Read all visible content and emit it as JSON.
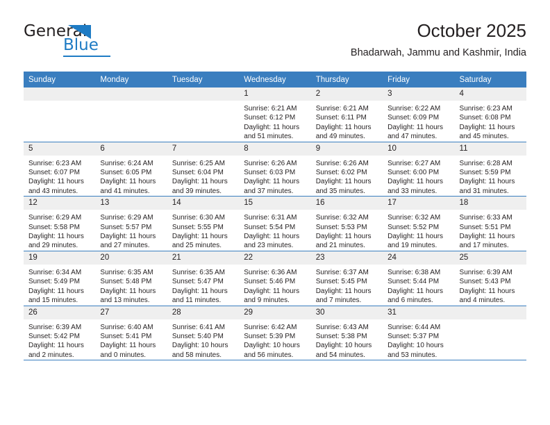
{
  "brand": {
    "name_top": "General",
    "name_bottom": "Blue",
    "accent_color": "#1e7bc4",
    "triangle_icon": "brand-triangle-icon"
  },
  "header": {
    "title": "October 2025",
    "subtitle": "Bhadarwah, Jammu and Kashmir, India"
  },
  "theme": {
    "header_row_bg": "#3a7ebf",
    "daynum_bg": "#efefef",
    "row_border": "#3a7ebf",
    "text": "#231f20"
  },
  "calendar": {
    "weekday_headers": [
      "Sunday",
      "Monday",
      "Tuesday",
      "Wednesday",
      "Thursday",
      "Friday",
      "Saturday"
    ],
    "weeks": [
      [
        {
          "day": "",
          "lines": []
        },
        {
          "day": "",
          "lines": []
        },
        {
          "day": "",
          "lines": []
        },
        {
          "day": "1",
          "lines": [
            "Sunrise: 6:21 AM",
            "Sunset: 6:12 PM",
            "Daylight: 11 hours",
            "and 51 minutes."
          ]
        },
        {
          "day": "2",
          "lines": [
            "Sunrise: 6:21 AM",
            "Sunset: 6:11 PM",
            "Daylight: 11 hours",
            "and 49 minutes."
          ]
        },
        {
          "day": "3",
          "lines": [
            "Sunrise: 6:22 AM",
            "Sunset: 6:09 PM",
            "Daylight: 11 hours",
            "and 47 minutes."
          ]
        },
        {
          "day": "4",
          "lines": [
            "Sunrise: 6:23 AM",
            "Sunset: 6:08 PM",
            "Daylight: 11 hours",
            "and 45 minutes."
          ]
        }
      ],
      [
        {
          "day": "5",
          "lines": [
            "Sunrise: 6:23 AM",
            "Sunset: 6:07 PM",
            "Daylight: 11 hours",
            "and 43 minutes."
          ]
        },
        {
          "day": "6",
          "lines": [
            "Sunrise: 6:24 AM",
            "Sunset: 6:05 PM",
            "Daylight: 11 hours",
            "and 41 minutes."
          ]
        },
        {
          "day": "7",
          "lines": [
            "Sunrise: 6:25 AM",
            "Sunset: 6:04 PM",
            "Daylight: 11 hours",
            "and 39 minutes."
          ]
        },
        {
          "day": "8",
          "lines": [
            "Sunrise: 6:26 AM",
            "Sunset: 6:03 PM",
            "Daylight: 11 hours",
            "and 37 minutes."
          ]
        },
        {
          "day": "9",
          "lines": [
            "Sunrise: 6:26 AM",
            "Sunset: 6:02 PM",
            "Daylight: 11 hours",
            "and 35 minutes."
          ]
        },
        {
          "day": "10",
          "lines": [
            "Sunrise: 6:27 AM",
            "Sunset: 6:00 PM",
            "Daylight: 11 hours",
            "and 33 minutes."
          ]
        },
        {
          "day": "11",
          "lines": [
            "Sunrise: 6:28 AM",
            "Sunset: 5:59 PM",
            "Daylight: 11 hours",
            "and 31 minutes."
          ]
        }
      ],
      [
        {
          "day": "12",
          "lines": [
            "Sunrise: 6:29 AM",
            "Sunset: 5:58 PM",
            "Daylight: 11 hours",
            "and 29 minutes."
          ]
        },
        {
          "day": "13",
          "lines": [
            "Sunrise: 6:29 AM",
            "Sunset: 5:57 PM",
            "Daylight: 11 hours",
            "and 27 minutes."
          ]
        },
        {
          "day": "14",
          "lines": [
            "Sunrise: 6:30 AM",
            "Sunset: 5:55 PM",
            "Daylight: 11 hours",
            "and 25 minutes."
          ]
        },
        {
          "day": "15",
          "lines": [
            "Sunrise: 6:31 AM",
            "Sunset: 5:54 PM",
            "Daylight: 11 hours",
            "and 23 minutes."
          ]
        },
        {
          "day": "16",
          "lines": [
            "Sunrise: 6:32 AM",
            "Sunset: 5:53 PM",
            "Daylight: 11 hours",
            "and 21 minutes."
          ]
        },
        {
          "day": "17",
          "lines": [
            "Sunrise: 6:32 AM",
            "Sunset: 5:52 PM",
            "Daylight: 11 hours",
            "and 19 minutes."
          ]
        },
        {
          "day": "18",
          "lines": [
            "Sunrise: 6:33 AM",
            "Sunset: 5:51 PM",
            "Daylight: 11 hours",
            "and 17 minutes."
          ]
        }
      ],
      [
        {
          "day": "19",
          "lines": [
            "Sunrise: 6:34 AM",
            "Sunset: 5:49 PM",
            "Daylight: 11 hours",
            "and 15 minutes."
          ]
        },
        {
          "day": "20",
          "lines": [
            "Sunrise: 6:35 AM",
            "Sunset: 5:48 PM",
            "Daylight: 11 hours",
            "and 13 minutes."
          ]
        },
        {
          "day": "21",
          "lines": [
            "Sunrise: 6:35 AM",
            "Sunset: 5:47 PM",
            "Daylight: 11 hours",
            "and 11 minutes."
          ]
        },
        {
          "day": "22",
          "lines": [
            "Sunrise: 6:36 AM",
            "Sunset: 5:46 PM",
            "Daylight: 11 hours",
            "and 9 minutes."
          ]
        },
        {
          "day": "23",
          "lines": [
            "Sunrise: 6:37 AM",
            "Sunset: 5:45 PM",
            "Daylight: 11 hours",
            "and 7 minutes."
          ]
        },
        {
          "day": "24",
          "lines": [
            "Sunrise: 6:38 AM",
            "Sunset: 5:44 PM",
            "Daylight: 11 hours",
            "and 6 minutes."
          ]
        },
        {
          "day": "25",
          "lines": [
            "Sunrise: 6:39 AM",
            "Sunset: 5:43 PM",
            "Daylight: 11 hours",
            "and 4 minutes."
          ]
        }
      ],
      [
        {
          "day": "26",
          "lines": [
            "Sunrise: 6:39 AM",
            "Sunset: 5:42 PM",
            "Daylight: 11 hours",
            "and 2 minutes."
          ]
        },
        {
          "day": "27",
          "lines": [
            "Sunrise: 6:40 AM",
            "Sunset: 5:41 PM",
            "Daylight: 11 hours",
            "and 0 minutes."
          ]
        },
        {
          "day": "28",
          "lines": [
            "Sunrise: 6:41 AM",
            "Sunset: 5:40 PM",
            "Daylight: 10 hours",
            "and 58 minutes."
          ]
        },
        {
          "day": "29",
          "lines": [
            "Sunrise: 6:42 AM",
            "Sunset: 5:39 PM",
            "Daylight: 10 hours",
            "and 56 minutes."
          ]
        },
        {
          "day": "30",
          "lines": [
            "Sunrise: 6:43 AM",
            "Sunset: 5:38 PM",
            "Daylight: 10 hours",
            "and 54 minutes."
          ]
        },
        {
          "day": "31",
          "lines": [
            "Sunrise: 6:44 AM",
            "Sunset: 5:37 PM",
            "Daylight: 10 hours",
            "and 53 minutes."
          ]
        },
        {
          "day": "",
          "lines": []
        }
      ]
    ]
  }
}
